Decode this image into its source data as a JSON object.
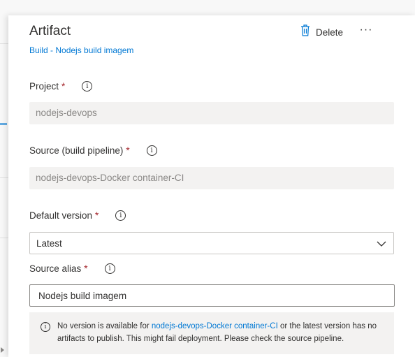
{
  "panel": {
    "title": "Artifact",
    "subtitle": "Build - Nodejs build imagem",
    "delete_label": "Delete",
    "more_label": "···"
  },
  "fields": {
    "project": {
      "label": "Project",
      "required_mark": "*",
      "value": "nodejs-devops"
    },
    "source": {
      "label": "Source (build pipeline)",
      "required_mark": "*",
      "value": "nodejs-devops-Docker container-CI"
    },
    "default_version": {
      "label": "Default version",
      "required_mark": "*",
      "value": "Latest"
    },
    "source_alias": {
      "label": "Source alias",
      "required_mark": "*",
      "value": "Nodejs build imagem"
    }
  },
  "warning": {
    "text_before": "No version is available for",
    "link": "nodejs-devops-Docker container-CI",
    "text_after": "or the latest version has no artifacts to publish. This might fail deployment. Please check the source pipeline."
  },
  "icons": {
    "info": "info-icon",
    "delete": "trash-icon",
    "dropdown": "chevron-down-icon"
  },
  "colors": {
    "accent": "#0078d4",
    "required": "#a4262c",
    "readonly_bg": "#f3f2f1"
  }
}
